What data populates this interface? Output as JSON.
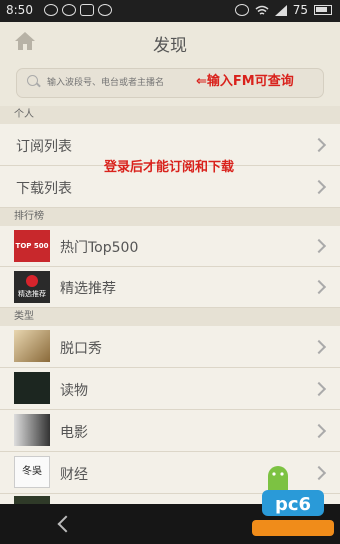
{
  "status": {
    "time": "8:50",
    "battery": "75"
  },
  "header": {
    "title": "发现"
  },
  "search": {
    "placeholder": "输入波段号、电台或者主播名",
    "annotation": "⇐输入FM可查询"
  },
  "annotation_login": "登录后才能订阅和下载",
  "sections": {
    "personal": {
      "label": "个人",
      "items": [
        {
          "label": "订阅列表"
        },
        {
          "label": "下载列表"
        }
      ]
    },
    "ranking": {
      "label": "排行榜",
      "items": [
        {
          "label": "热门Top500",
          "thumb_text": "TOP 500"
        },
        {
          "label": "精选推荐",
          "thumb_text": "精选推荐"
        }
      ]
    },
    "types": {
      "label": "类型",
      "items": [
        {
          "label": "脱口秀"
        },
        {
          "label": "读物"
        },
        {
          "label": "电影"
        },
        {
          "label": "财经",
          "thumb_text": "冬吳"
        }
      ]
    }
  },
  "watermark": {
    "text": "pc6"
  },
  "colors": {
    "annotation": "#d9221c",
    "header_bg": "#ece8dc",
    "list_bg": "#f3f0e8",
    "accent": "#2a9ad8"
  }
}
